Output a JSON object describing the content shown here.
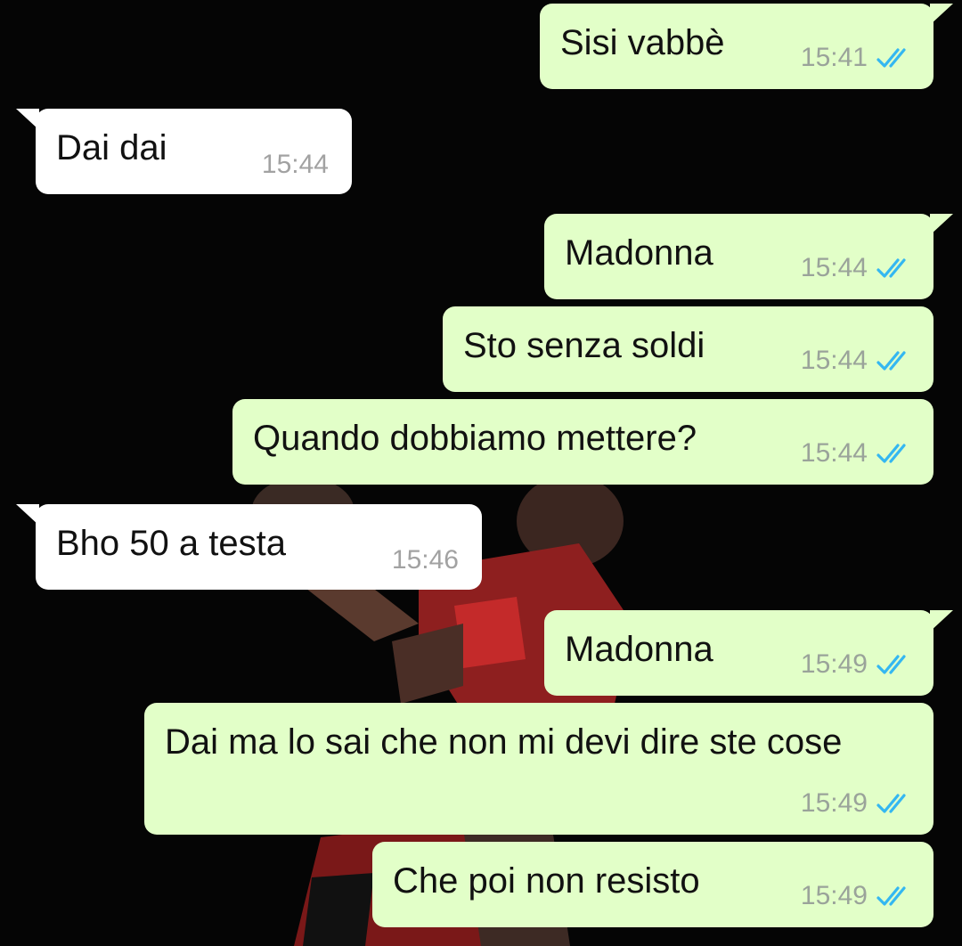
{
  "colors": {
    "outgoing_bubble": "#e2ffc8",
    "incoming_bubble": "#ffffff",
    "read_receipt": "#34b7f1",
    "wallpaper": "#000000"
  },
  "wallpaper": {
    "icon": "basketball-player-photo"
  },
  "messages": [
    {
      "direction": "outgoing",
      "text": "Sisi vabbè",
      "time": "15:41",
      "status": "read",
      "status_icon": "double-check-icon"
    },
    {
      "direction": "incoming",
      "text": "Dai dai",
      "time": "15:44"
    },
    {
      "direction": "outgoing",
      "text": "Madonna",
      "time": "15:44",
      "status": "read",
      "status_icon": "double-check-icon"
    },
    {
      "direction": "outgoing",
      "text": "Sto senza soldi",
      "time": "15:44",
      "status": "read",
      "status_icon": "double-check-icon"
    },
    {
      "direction": "outgoing",
      "text": "Quando dobbiamo mettere?",
      "time": "15:44",
      "status": "read",
      "status_icon": "double-check-icon"
    },
    {
      "direction": "incoming",
      "text": "Bho 50 a testa",
      "time": "15:46"
    },
    {
      "direction": "outgoing",
      "text": "Madonna",
      "time": "15:49",
      "status": "read",
      "status_icon": "double-check-icon"
    },
    {
      "direction": "outgoing",
      "text": "Dai ma lo sai che non mi devi dire ste cose",
      "time": "15:49",
      "status": "read",
      "status_icon": "double-check-icon"
    },
    {
      "direction": "outgoing",
      "text": "Che poi non resisto",
      "time": "15:49",
      "status": "read",
      "status_icon": "double-check-icon"
    }
  ]
}
